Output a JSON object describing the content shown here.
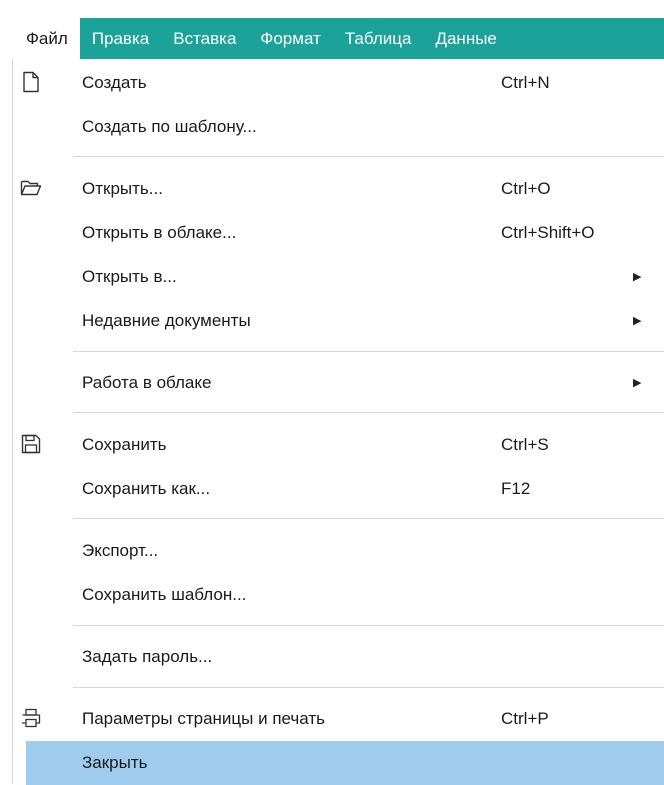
{
  "menubar": {
    "items": [
      {
        "label": "Файл"
      },
      {
        "label": "Правка"
      },
      {
        "label": "Вставка"
      },
      {
        "label": "Формат"
      },
      {
        "label": "Таблица"
      },
      {
        "label": "Данные"
      }
    ]
  },
  "file_menu": {
    "items": [
      {
        "label": "Создать",
        "shortcut": "Ctrl+N",
        "icon": "new-document-icon"
      },
      {
        "label": "Создать по шаблону..."
      },
      {
        "label": "Открыть...",
        "shortcut": "Ctrl+O",
        "icon": "open-folder-icon"
      },
      {
        "label": "Открыть в облаке...",
        "shortcut": "Ctrl+Shift+O"
      },
      {
        "label": "Открыть в...",
        "submenu": true
      },
      {
        "label": "Недавние документы",
        "submenu": true
      },
      {
        "label": "Работа в облаке",
        "submenu": true
      },
      {
        "label": "Сохранить",
        "shortcut": "Ctrl+S",
        "icon": "save-icon"
      },
      {
        "label": "Сохранить как...",
        "shortcut": "F12"
      },
      {
        "label": "Экспорт..."
      },
      {
        "label": "Сохранить шаблон..."
      },
      {
        "label": "Задать пароль..."
      },
      {
        "label": "Параметры страницы и печать",
        "shortcut": "Ctrl+P",
        "icon": "printer-icon"
      },
      {
        "label": "Закрыть",
        "highlighted": true
      }
    ]
  },
  "colors": {
    "menubar_bg": "#1ba39a",
    "highlight_bg": "#9ecbee"
  }
}
